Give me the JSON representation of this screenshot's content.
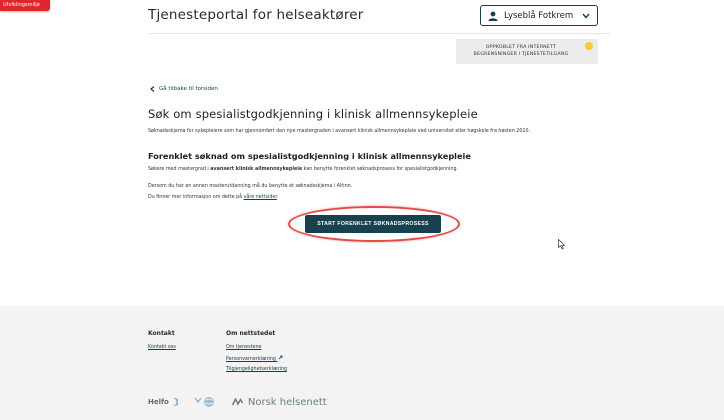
{
  "env_badge": "Utviklingsmiljø",
  "header": {
    "title": "Tjenesteportal for helseaktører",
    "user_name": "Lyseblå Fotkrem"
  },
  "notice": {
    "line1": "OPPKOBLET FRA INTERNETT",
    "line2": "BEGRENSNINGER I TJENESTETILGANG",
    "status_color": "#f1cc3b"
  },
  "nav": {
    "back_label": "Gå tilbake til forsiden"
  },
  "main": {
    "title": "Søk om spesialistgodkjenning i klinisk allmennsykepleie",
    "intro": "Søknadsskjema for sykepleiere som har gjennomført den nye mastergraden i avansert klinisk allmennsykepleie ved universitet eller høgskole fra høsten 2020.",
    "subtitle": "Forenklet søknad om spesialistgodkjenning i klinisk allmennsykepleie",
    "p2_before": "Søkere med mastergrad i ",
    "p2_bold": "avansert klinisk allmennsykepleie",
    "p2_after": " kan benytte forenklet søknadsprosess for spesialistgodkjenning.",
    "p3": "Dersom du har en annen masterutdanning må du benytte et søknadsskjema i Altinn.",
    "p4_before": "Du finner mer informasjon om dette på ",
    "p4_link": "våre nettsider",
    "p4_after": ".",
    "cta_label": "START FORENKLET SØKNADSPROSESS"
  },
  "footer": {
    "contact_heading": "Kontakt",
    "contact_link": "Kontakt oss",
    "about_heading": "Om nettstedet",
    "about_links": [
      "Om tjenestene",
      "Personvernerklæring",
      "Tilgjengelighetserklæring"
    ],
    "logos": {
      "helfo": "Helfo",
      "nhn": "Norsk helsenett"
    }
  },
  "colors": {
    "primary": "#17414f",
    "highlight_ring": "#e34a4a",
    "badge": "#e0262b"
  }
}
